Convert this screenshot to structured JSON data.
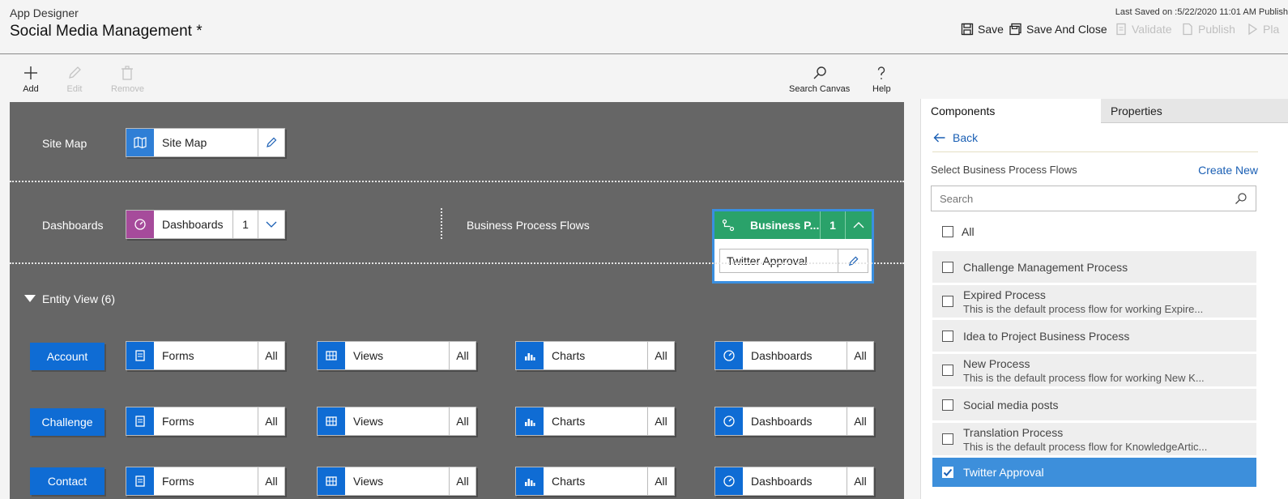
{
  "header": {
    "app_name": "App Designer",
    "title": "Social Media Management *",
    "last_saved": "Last Saved on :5/22/2020 11:01 AM Publish",
    "save_label": "Save",
    "save_close_label": "Save And Close",
    "validate_label": "Validate",
    "publish_label": "Publish",
    "play_label": "Pla"
  },
  "toolbar": {
    "add_label": "Add",
    "edit_label": "Edit",
    "remove_label": "Remove",
    "search_canvas_label": "Search Canvas",
    "help_label": "Help"
  },
  "canvas": {
    "site_map_row_label": "Site Map",
    "site_map_tile_label": "Site Map",
    "dashboards_row_label": "Dashboards",
    "dashboards_tile_label": "Dashboards",
    "dashboards_count": "1",
    "bpf_row_label": "Business Process Flows",
    "bpf_tile_label": "Business P...",
    "bpf_count": "1",
    "bpf_item": "Twitter Approval",
    "entity_view_label": "Entity View (6)",
    "entities": [
      {
        "name": "Account",
        "forms": "Forms",
        "views": "Views",
        "charts": "Charts",
        "dashboards": "Dashboards",
        "all": "All"
      },
      {
        "name": "Challenge",
        "forms": "Forms",
        "views": "Views",
        "charts": "Charts",
        "dashboards": "Dashboards",
        "all": "All"
      },
      {
        "name": "Contact",
        "forms": "Forms",
        "views": "Views",
        "charts": "Charts",
        "dashboards": "Dashboards",
        "all": "All"
      }
    ]
  },
  "panel": {
    "tab_components": "Components",
    "tab_properties": "Properties",
    "back_label": "Back",
    "select_label": "Select Business Process Flows",
    "create_new_label": "Create New",
    "search_placeholder": "Search",
    "all_label": "All",
    "items": [
      {
        "name": "Challenge Management Process",
        "desc": ""
      },
      {
        "name": "Expired Process",
        "desc": "This is the default process flow for working Expire..."
      },
      {
        "name": "Idea to Project Business Process",
        "desc": ""
      },
      {
        "name": "New Process",
        "desc": "This is the default process flow for working New K..."
      },
      {
        "name": "Social media posts",
        "desc": ""
      },
      {
        "name": "Translation Process",
        "desc": "This is the default process flow for KnowledgeArtic..."
      },
      {
        "name": "Twitter Approval",
        "desc": ""
      }
    ]
  },
  "colors": {
    "accent_blue": "#0f6cd4",
    "bpf_green": "#2aa26a",
    "dashboard_purple": "#a64b9b",
    "selected_blue": "#3d8fdb",
    "canvas_gray": "#666666"
  }
}
